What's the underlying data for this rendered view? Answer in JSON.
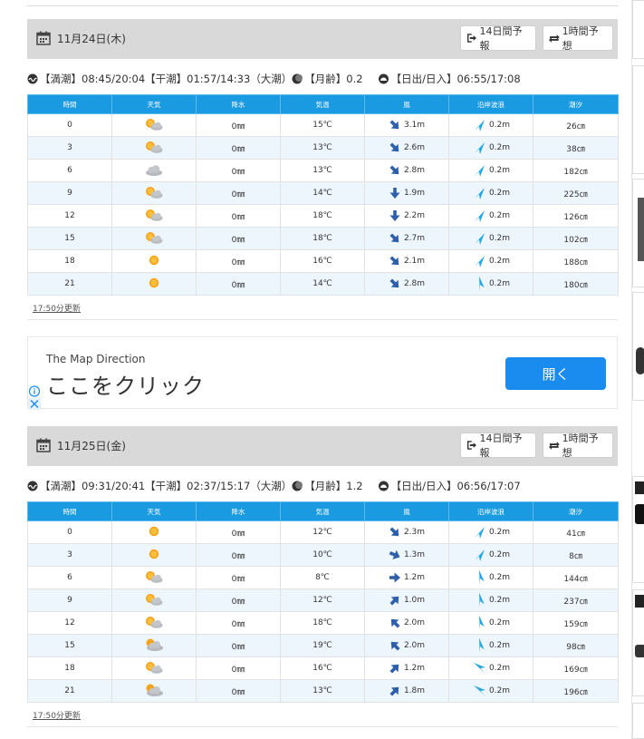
{
  "days": [
    {
      "title": "11月24日(木)",
      "btn14": "14日間予報",
      "btn1h": "1時間予想",
      "info": {
        "high": "【満潮】08:45/20:04",
        "low": "【干潮】01:57/14:33",
        "tide": "（大潮）",
        "moon": "【月齢】0.2",
        "sun": "【日出/日入】06:55/17:08"
      },
      "rows": [
        {
          "time": "0",
          "weather": "sun-cloud-icon",
          "rain": "0㎜",
          "temp": "15℃",
          "windDir": "se",
          "wind": "3.1m",
          "waveDir": "ne",
          "wave": "0.2m",
          "tide": "26㎝"
        },
        {
          "time": "3",
          "weather": "sun-cloud-icon",
          "rain": "0㎜",
          "temp": "13℃",
          "windDir": "se",
          "wind": "2.6m",
          "waveDir": "ne",
          "wave": "0.2m",
          "tide": "38㎝"
        },
        {
          "time": "6",
          "weather": "cloud-icon",
          "rain": "0㎜",
          "temp": "13℃",
          "windDir": "se",
          "wind": "2.8m",
          "waveDir": "ne",
          "wave": "0.2m",
          "tide": "182㎝"
        },
        {
          "time": "9",
          "weather": "sun-cloud-icon",
          "rain": "0㎜",
          "temp": "14℃",
          "windDir": "s",
          "wind": "1.9m",
          "waveDir": "ne",
          "wave": "0.2m",
          "tide": "225㎝"
        },
        {
          "time": "12",
          "weather": "sun-cloud-icon",
          "rain": "0㎜",
          "temp": "18℃",
          "windDir": "s",
          "wind": "2.2m",
          "waveDir": "ne",
          "wave": "0.2m",
          "tide": "126㎝"
        },
        {
          "time": "15",
          "weather": "sun-cloud-icon",
          "rain": "0㎜",
          "temp": "18℃",
          "windDir": "se",
          "wind": "2.7m",
          "waveDir": "ne",
          "wave": "0.2m",
          "tide": "102㎝"
        },
        {
          "time": "18",
          "weather": "sun-icon",
          "rain": "0㎜",
          "temp": "16℃",
          "windDir": "se",
          "wind": "2.1m",
          "waveDir": "ne",
          "wave": "0.2m",
          "tide": "188㎝"
        },
        {
          "time": "21",
          "weather": "sun-icon",
          "rain": "0㎜",
          "temp": "14℃",
          "windDir": "se",
          "wind": "2.8m",
          "waveDir": "w",
          "wave": "0.2m",
          "tide": "180㎝"
        }
      ],
      "updated": "17:50分更新"
    },
    {
      "title": "11月25日(金)",
      "btn14": "14日間予報",
      "btn1h": "1時間予想",
      "info": {
        "high": "【満潮】09:31/20:41",
        "low": "【干潮】02:37/15:17",
        "tide": "（大潮）",
        "moon": "【月齢】1.2",
        "sun": "【日出/日入】06:56/17:07"
      },
      "rows": [
        {
          "time": "0",
          "weather": "sun-icon",
          "rain": "0㎜",
          "temp": "12℃",
          "windDir": "se",
          "wind": "2.3m",
          "waveDir": "ne",
          "wave": "0.2m",
          "tide": "41㎝"
        },
        {
          "time": "3",
          "weather": "sun-icon",
          "rain": "0㎜",
          "temp": "10℃",
          "windDir": "ese",
          "wind": "1.3m",
          "waveDir": "ne",
          "wave": "0.2m",
          "tide": "8㎝"
        },
        {
          "time": "6",
          "weather": "sun-cloud-icon",
          "rain": "0㎜",
          "temp": "8℃",
          "windDir": "e",
          "wind": "1.2m",
          "waveDir": "w",
          "wave": "0.2m",
          "tide": "144㎝"
        },
        {
          "time": "9",
          "weather": "sun-cloud-icon",
          "rain": "0㎜",
          "temp": "12℃",
          "windDir": "ne",
          "wind": "1.0m",
          "waveDir": "w",
          "wave": "0.2m",
          "tide": "237㎝"
        },
        {
          "time": "12",
          "weather": "sun-cloud-icon",
          "rain": "0㎜",
          "temp": "18℃",
          "windDir": "nw",
          "wind": "2.0m",
          "waveDir": "w",
          "wave": "0.2m",
          "tide": "159㎝"
        },
        {
          "time": "15",
          "weather": "cloud-sun-icon",
          "rain": "0㎜",
          "temp": "19℃",
          "windDir": "nw",
          "wind": "2.0m",
          "waveDir": "w",
          "wave": "0.2m",
          "tide": "98㎝"
        },
        {
          "time": "18",
          "weather": "sun-cloud-icon",
          "rain": "0㎜",
          "temp": "16℃",
          "windDir": "ne",
          "wind": "1.2m",
          "waveDir": "nw",
          "wave": "0.2m",
          "tide": "169㎝"
        },
        {
          "time": "21",
          "weather": "cloud-sun-icon",
          "rain": "0㎜",
          "temp": "13℃",
          "windDir": "ne",
          "wind": "1.8m",
          "waveDir": "nw",
          "wave": "0.2m",
          "tide": "196㎝"
        }
      ],
      "updated": "17:50分更新"
    }
  ],
  "columns": [
    "時間",
    "天気",
    "降水",
    "気温",
    "風",
    "沿岸波浪",
    "潮汐"
  ],
  "ad": {
    "brand": "The Map Direction",
    "cta": "ここをクリック",
    "button": "開く"
  },
  "colors": {
    "header_blue": "#1a9ae0",
    "wind_arrow": "#2f5fa8",
    "wave_arrow": "#29a8e0",
    "ad_button": "#1a8cf0"
  }
}
